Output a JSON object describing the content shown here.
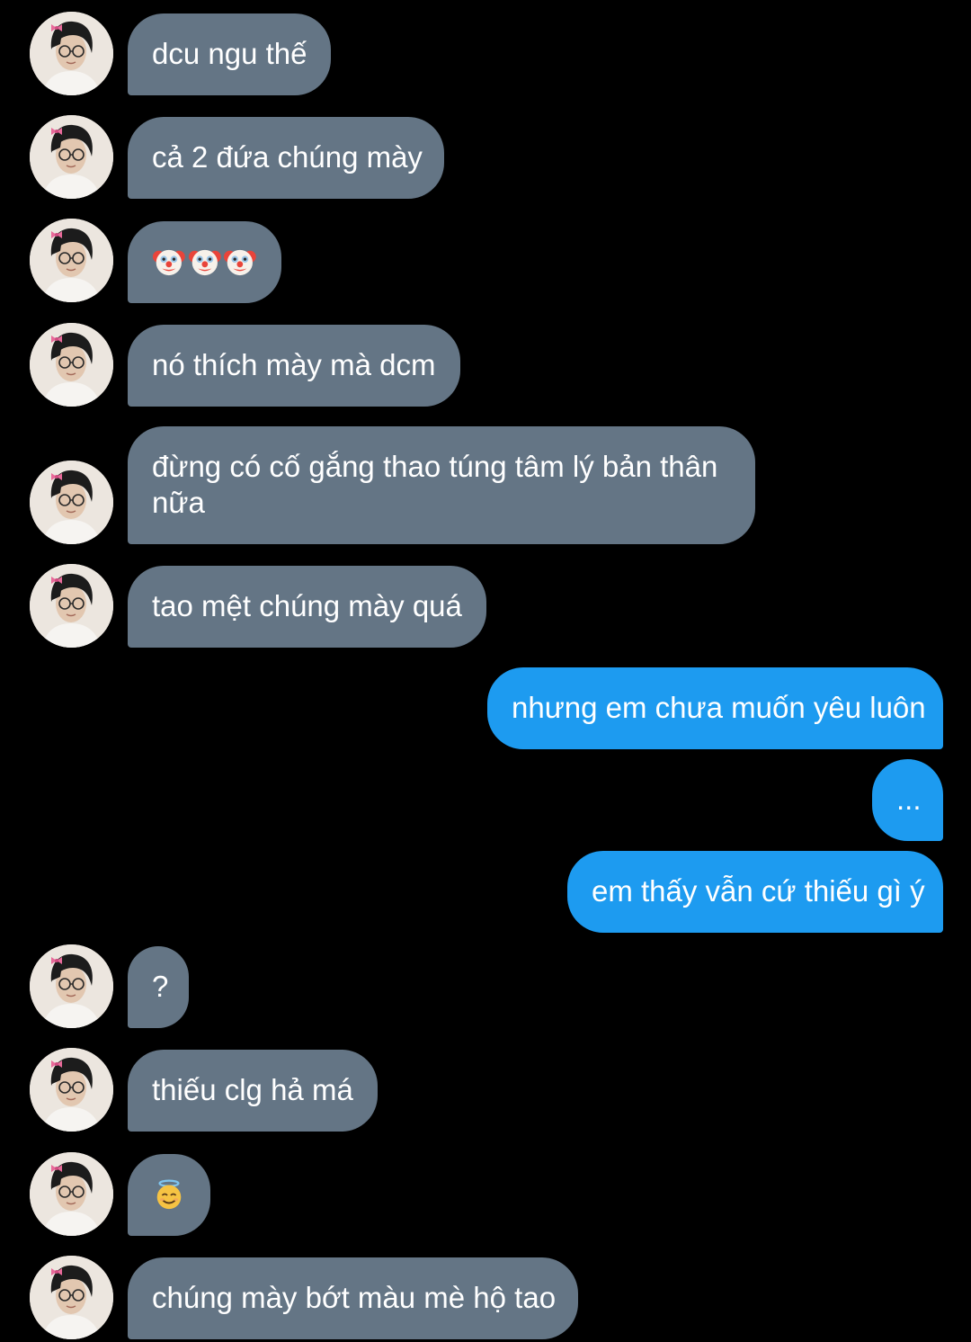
{
  "conversation": {
    "messages": [
      {
        "sender": "them",
        "text": "dcu ngu thế"
      },
      {
        "sender": "them",
        "text": "cả 2 đứa chúng mày"
      },
      {
        "sender": "them",
        "emojis": [
          "clown-face",
          "clown-face",
          "clown-face"
        ]
      },
      {
        "sender": "them",
        "text": "nó thích mày mà dcm"
      },
      {
        "sender": "them",
        "text": "đừng có cố gắng thao túng tâm lý bản thân nữa"
      },
      {
        "sender": "them",
        "text": "tao mệt chúng mày quá"
      },
      {
        "sender": "me",
        "text": "nhưng em chưa muốn yêu luôn"
      },
      {
        "sender": "me",
        "text": "..."
      },
      {
        "sender": "me",
        "text": "em thấy vẫn cứ thiếu gì ý"
      },
      {
        "sender": "them",
        "text": "?"
      },
      {
        "sender": "them",
        "text": "thiếu clg hả má"
      },
      {
        "sender": "them",
        "emojis": [
          "smiling-face-with-halo"
        ]
      },
      {
        "sender": "them",
        "text": "chúng mày bớt màu mè hộ tao"
      }
    ]
  },
  "colors": {
    "background": "#000000",
    "incoming_bubble": "#647585",
    "outgoing_bubble": "#1d9bf0",
    "text": "#ffffff"
  }
}
